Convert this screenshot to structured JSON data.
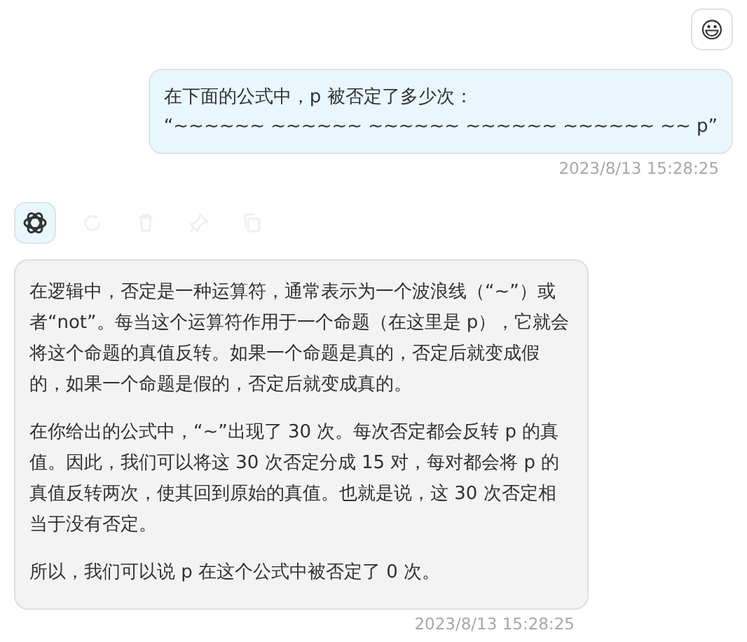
{
  "messages": [
    {
      "kind": "user",
      "avatar": "😃",
      "lines": [
        "在下面的公式中，p 被否定了多少次：",
        "“~~~~~~ ~~~~~~ ~~~~~~ ~~~~~~ ~~~~~~ ~~ p”"
      ],
      "time": "2023/8/13 15:28:25"
    },
    {
      "kind": "assistant",
      "paragraphs": [
        "在逻辑中，否定是一种运算符，通常表示为一个波浪线（“~”）或者“not”。每当这个运算符作用于一个命题（在这里是 p），它就会将这个命题的真值反转。如果一个命题是真的，否定后就变成假的，如果一个命题是假的，否定后就变成真的。",
        "在你给出的公式中，“~”出现了 30 次。每次否定都会反转 p 的真值。因此，我们可以将这 30 次否定分成 15 对，每对都会将 p 的真值反转两次，使其回到原始的真值。也就是说，这 30 次否定相当于没有否定。",
        "所以，我们可以说 p 在这个公式中被否定了 0 次。"
      ],
      "time": "2023/8/13 15:28:25"
    }
  ]
}
